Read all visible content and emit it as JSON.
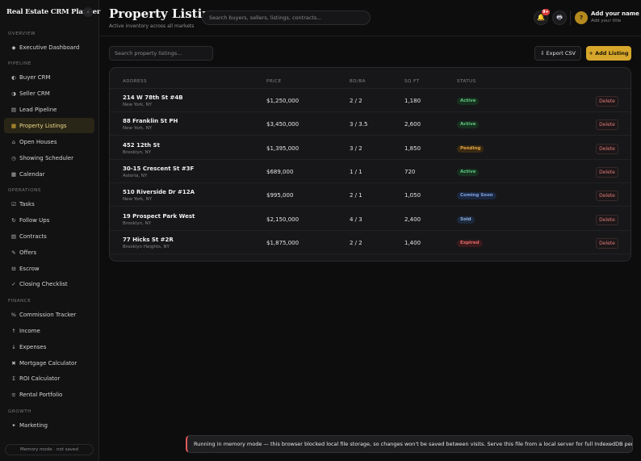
{
  "app": {
    "brand": "Real Estate CRM Planner",
    "collapse_icon": "chevron-left-icon",
    "collapse_glyph": "‹"
  },
  "sidebar": {
    "sections": [
      {
        "label": "OVERVIEW"
      },
      {
        "label": "PIPELINE"
      },
      {
        "label": "OPERATIONS"
      },
      {
        "label": "FINANCE"
      },
      {
        "label": "GROWTH"
      }
    ],
    "items": [
      {
        "label": "Executive Dashboard",
        "icon": "diamond-icon",
        "glyph": "◆"
      },
      {
        "label": "Buyer CRM",
        "icon": "half-circle-icon",
        "glyph": "◐"
      },
      {
        "label": "Seller CRM",
        "icon": "half-circle-alt-icon",
        "glyph": "◑"
      },
      {
        "label": "Lead Pipeline",
        "icon": "pipeline-icon",
        "glyph": "▤"
      },
      {
        "label": "Property Listings",
        "icon": "listing-icon",
        "glyph": "▦",
        "active": true
      },
      {
        "label": "Open Houses",
        "icon": "home-icon",
        "glyph": "⌂"
      },
      {
        "label": "Showing Scheduler",
        "icon": "clock-icon",
        "glyph": "◷"
      },
      {
        "label": "Calendar",
        "icon": "calendar-icon",
        "glyph": "▦"
      },
      {
        "label": "Tasks",
        "icon": "checkbox-icon",
        "glyph": "☑"
      },
      {
        "label": "Follow Ups",
        "icon": "refresh-icon",
        "glyph": "↻"
      },
      {
        "label": "Contracts",
        "icon": "document-icon",
        "glyph": "▤"
      },
      {
        "label": "Offers",
        "icon": "pen-icon",
        "glyph": "✎"
      },
      {
        "label": "Escrow",
        "icon": "vault-icon",
        "glyph": "⊟"
      },
      {
        "label": "Closing Checklist",
        "icon": "check-icon",
        "glyph": "✓"
      },
      {
        "label": "Commission Tracker",
        "icon": "percent-icon",
        "glyph": "%"
      },
      {
        "label": "Income",
        "icon": "arrow-up-icon",
        "glyph": "↑"
      },
      {
        "label": "Expenses",
        "icon": "arrow-down-icon",
        "glyph": "↓"
      },
      {
        "label": "Mortgage Calculator",
        "icon": "multiply-icon",
        "glyph": "✖"
      },
      {
        "label": "ROI Calculator",
        "icon": "sigma-icon",
        "glyph": "Σ"
      },
      {
        "label": "Rental Portfolio",
        "icon": "equals-icon",
        "glyph": "≡"
      },
      {
        "label": "Marketing",
        "icon": "sparkle-icon",
        "glyph": "✦"
      }
    ],
    "memory_mode": "Memory mode · not saved"
  },
  "header": {
    "title": "Property Listings",
    "subtitle": "Active inventory across all markets",
    "search_placeholder": "Search buyers, sellers, listings, contracts...",
    "notifications_badge": "9+",
    "bell_glyph": "🔔",
    "printer_glyph": "🖶",
    "avatar_initial": "?",
    "user_name": "Add your name",
    "user_title": "Add your title"
  },
  "toolbar": {
    "search_placeholder": "Search property listings...",
    "export_label": "⇩ Export CSV",
    "add_label": "+ Add Listing"
  },
  "table": {
    "headers": [
      "ADDRESS",
      "PRICE",
      "BD/BA",
      "SQ FT",
      "STATUS"
    ],
    "rows": [
      {
        "address": "214 W 78th St #4B",
        "city": "New York, NY",
        "price": "$1,250,000",
        "bdba": "2 / 2",
        "sqft": "1,180",
        "status": "Active",
        "action": "Delete"
      },
      {
        "address": "88 Franklin St PH",
        "city": "New York, NY",
        "price": "$3,450,000",
        "bdba": "3 / 3.5",
        "sqft": "2,600",
        "status": "Active",
        "action": "Delete"
      },
      {
        "address": "452 12th St",
        "city": "Brooklyn, NY",
        "price": "$1,395,000",
        "bdba": "3 / 2",
        "sqft": "1,850",
        "status": "Pending",
        "action": "Delete"
      },
      {
        "address": "30-15 Crescent St #3F",
        "city": "Astoria, NY",
        "price": "$689,000",
        "bdba": "1 / 1",
        "sqft": "720",
        "status": "Active",
        "action": "Delete"
      },
      {
        "address": "510 Riverside Dr #12A",
        "city": "New York, NY",
        "price": "$995,000",
        "bdba": "2 / 1",
        "sqft": "1,050",
        "status": "Coming Soon",
        "action": "Delete"
      },
      {
        "address": "19 Prospect Park West",
        "city": "Brooklyn, NY",
        "price": "$2,150,000",
        "bdba": "4 / 3",
        "sqft": "2,400",
        "status": "Sold",
        "action": "Delete"
      },
      {
        "address": "77 Hicks St #2R",
        "city": "Brooklyn Heights, NY",
        "price": "$1,875,000",
        "bdba": "2 / 2",
        "sqft": "1,400",
        "status": "Expired",
        "action": "Delete"
      }
    ]
  },
  "status_colors": {
    "Active": {
      "bg": "#17301f",
      "fg": "#5fc47f"
    },
    "Pending": {
      "bg": "#3a2a12",
      "fg": "#e0a443"
    },
    "Coming Soon": {
      "bg": "#1b2740",
      "fg": "#7fa4e0"
    },
    "Sold": {
      "bg": "#1d2a3e",
      "fg": "#8fb0e0"
    },
    "Expired": {
      "bg": "#3a1a1c",
      "fg": "#e06a6a"
    }
  },
  "toast": {
    "message": "Running in memory mode — this browser blocked local file storage, so changes won't be saved between visits. Serve this file from a local server for full IndexedDB persistence."
  },
  "colors": {
    "accent": "#d7a72b",
    "background": "#0d0d0e",
    "sidebar": "#121213"
  }
}
